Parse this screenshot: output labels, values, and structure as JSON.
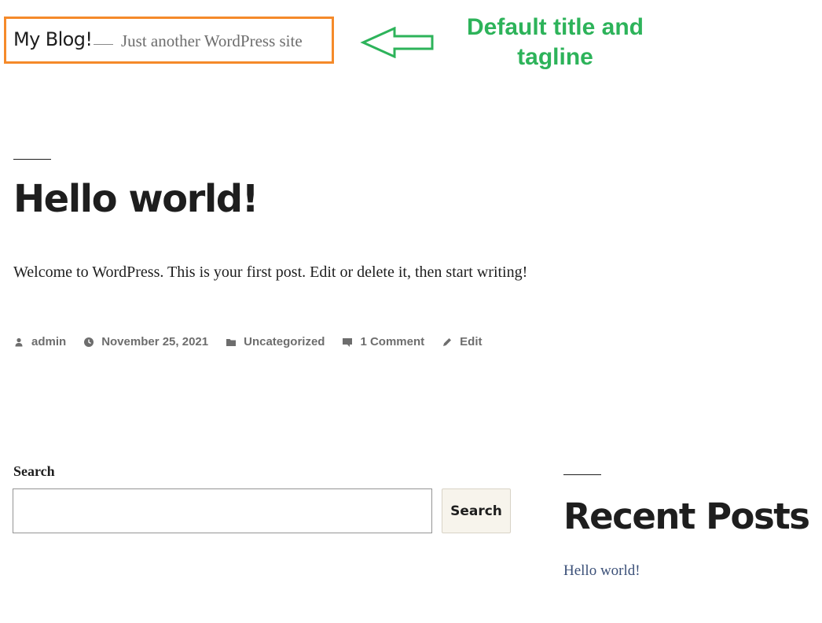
{
  "header": {
    "site_title": "My Blog!",
    "tagline": "Just another WordPress site",
    "separator": "—"
  },
  "annotation": {
    "line1": "Default title and",
    "line2": "tagline",
    "arrow_icon": "left-arrow-outline-icon",
    "box_color": "#f58a2a",
    "annotation_color": "#2db35a"
  },
  "post": {
    "title": "Hello world!",
    "excerpt": "Welcome to WordPress. This is your first post. Edit or delete it, then start writing!",
    "meta": [
      {
        "icon": "person-icon",
        "label": "admin"
      },
      {
        "icon": "clock-icon",
        "label": "November 25, 2021"
      },
      {
        "icon": "folder-icon",
        "label": "Uncategorized"
      },
      {
        "icon": "comment-icon",
        "label": "1 Comment"
      },
      {
        "icon": "pencil-icon",
        "label": "Edit"
      }
    ]
  },
  "search_widget": {
    "label": "Search",
    "value": "",
    "button_label": "Search"
  },
  "recent_posts": {
    "title": "Recent Posts",
    "items": [
      "Hello world!"
    ]
  },
  "colors": {
    "text": "#1e1e1e",
    "meta": "#6d6d6d",
    "link": "#3b5078"
  }
}
